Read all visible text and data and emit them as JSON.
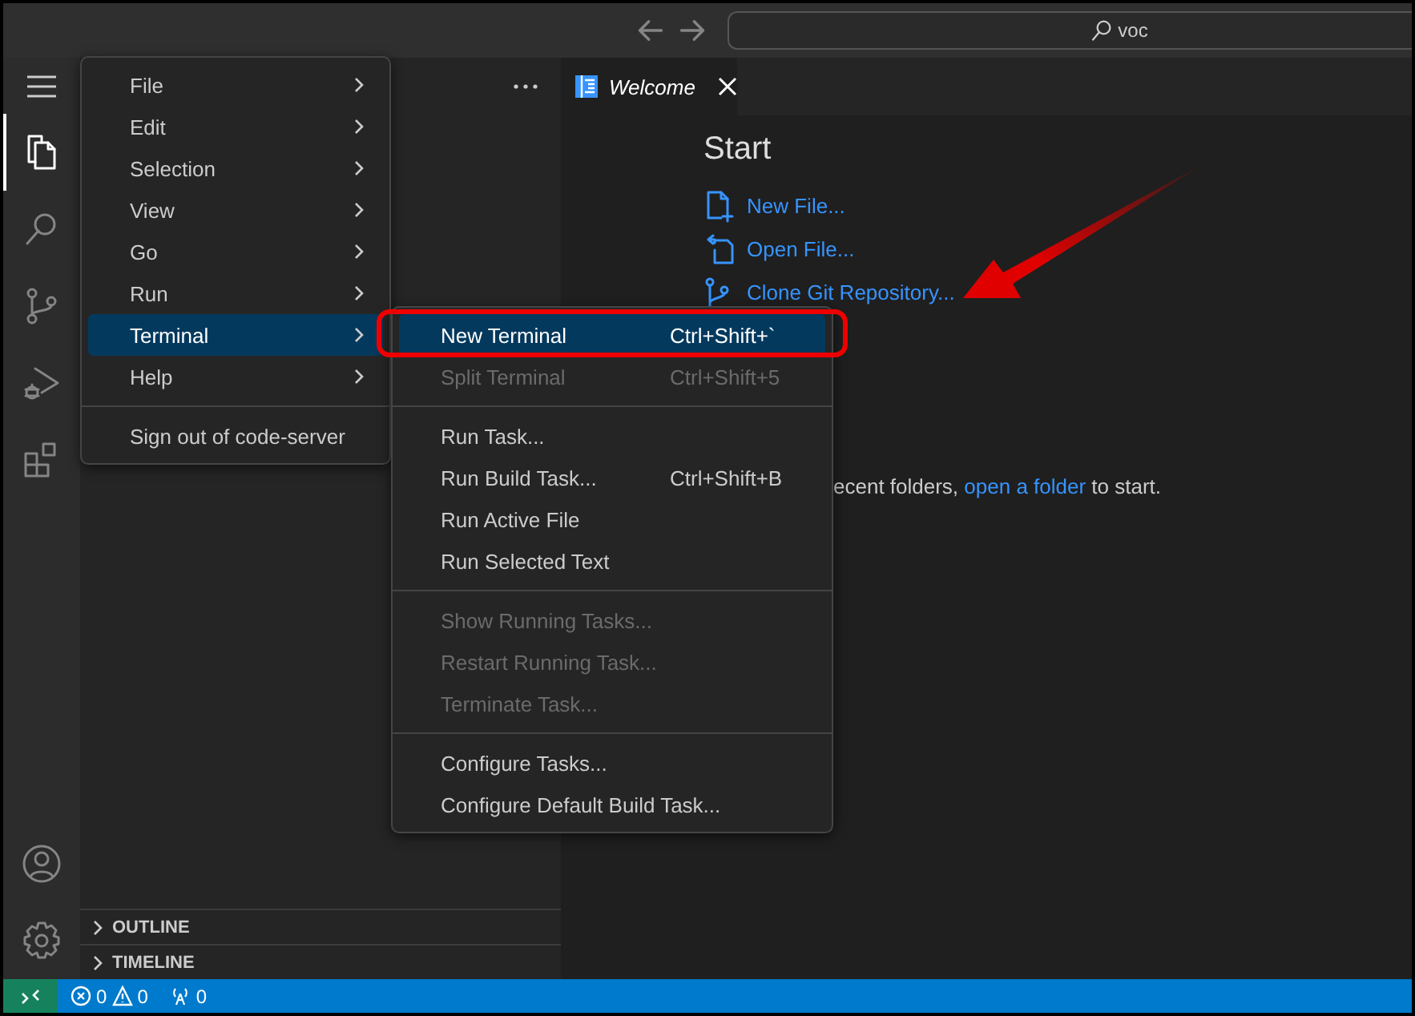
{
  "title_bar": {
    "search": "voc"
  },
  "activity_bar": {
    "items": [
      {
        "kind": "explorer",
        "selected": true
      },
      {
        "kind": "search",
        "selected": false
      },
      {
        "kind": "source-control",
        "selected": false
      },
      {
        "kind": "run-debug",
        "selected": false
      },
      {
        "kind": "extensions",
        "selected": false
      }
    ]
  },
  "sidebar": {
    "sections": [
      {
        "label": "OUTLINE",
        "expanded": false
      },
      {
        "label": "TIMELINE",
        "expanded": false
      }
    ]
  },
  "tabs": [
    {
      "label": "Welcome",
      "selected": true
    }
  ],
  "welcome": {
    "heading": "Start",
    "actions": [
      {
        "kind": "new-file",
        "label": "New File..."
      },
      {
        "kind": "open-file",
        "label": "Open File..."
      },
      {
        "kind": "clone",
        "label": "Clone Git Repository..."
      }
    ],
    "recent": {
      "before": "ecent folders,",
      "link": "open a folder",
      "after": "to start."
    }
  },
  "menu": {
    "items": [
      {
        "kind": "item",
        "label": "File",
        "submenu": true,
        "selected": false
      },
      {
        "kind": "item",
        "label": "Edit",
        "submenu": true,
        "selected": false
      },
      {
        "kind": "item",
        "label": "Selection",
        "submenu": true,
        "selected": false
      },
      {
        "kind": "item",
        "label": "View",
        "submenu": true,
        "selected": false
      },
      {
        "kind": "item",
        "label": "Go",
        "submenu": true,
        "selected": false
      },
      {
        "kind": "item",
        "label": "Run",
        "submenu": true,
        "selected": false
      },
      {
        "kind": "item",
        "label": "Terminal",
        "submenu": true,
        "selected": true
      },
      {
        "kind": "item",
        "label": "Help",
        "submenu": true,
        "selected": false
      },
      {
        "kind": "separator"
      },
      {
        "kind": "item",
        "label": "Sign out of code-server",
        "submenu": false,
        "selected": false
      }
    ]
  },
  "submenu": {
    "items": [
      {
        "kind": "item",
        "label": "New Terminal",
        "shortcut": "Ctrl+Shift+`",
        "selected": true,
        "disabled": false
      },
      {
        "kind": "item",
        "label": "Split Terminal",
        "shortcut": "Ctrl+Shift+5",
        "selected": false,
        "disabled": true
      },
      {
        "kind": "separator"
      },
      {
        "kind": "item",
        "label": "Run Task...",
        "selected": false,
        "disabled": false
      },
      {
        "kind": "item",
        "label": "Run Build Task...",
        "shortcut": "Ctrl+Shift+B",
        "selected": false,
        "disabled": false
      },
      {
        "kind": "item",
        "label": "Run Active File",
        "selected": false,
        "disabled": false
      },
      {
        "kind": "item",
        "label": "Run Selected Text",
        "selected": false,
        "disabled": false
      },
      {
        "kind": "separator"
      },
      {
        "kind": "item",
        "label": "Show Running Tasks...",
        "selected": false,
        "disabled": true
      },
      {
        "kind": "item",
        "label": "Restart Running Task...",
        "selected": false,
        "disabled": true
      },
      {
        "kind": "item",
        "label": "Terminate Task...",
        "selected": false,
        "disabled": true
      },
      {
        "kind": "separator"
      },
      {
        "kind": "item",
        "label": "Configure Tasks...",
        "selected": false,
        "disabled": false
      },
      {
        "kind": "item",
        "label": "Configure Default Build Task...",
        "selected": false,
        "disabled": false
      }
    ]
  },
  "status_bar": {
    "errors": "0",
    "warnings": "0",
    "ports": "0"
  }
}
